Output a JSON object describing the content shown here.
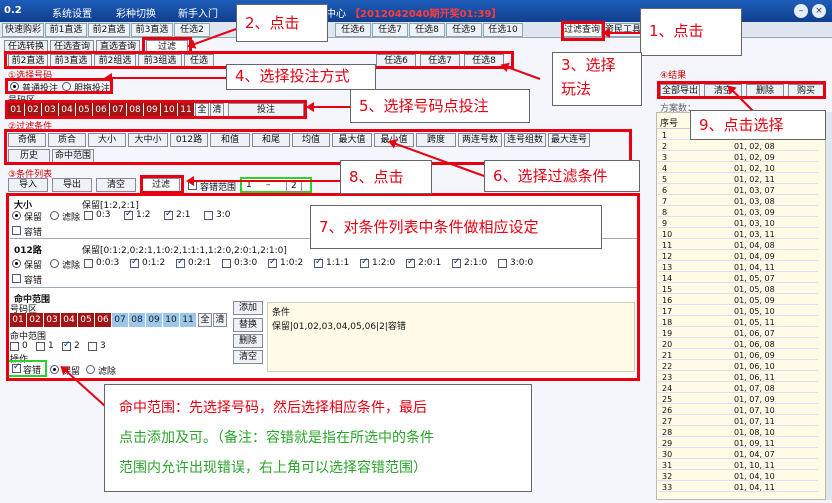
{
  "window": {
    "title": "0.2",
    "menu": [
      "系统设置",
      "彩种切换",
      "新手入门"
    ],
    "center": "中心",
    "notice": "【2012042040期开奖01:39】"
  },
  "tabs": [
    "快速购彩",
    "前1直选",
    "前2直选",
    "前3直选",
    "任选2",
    "任选3",
    "任选4",
    "任选5",
    "任选6",
    "任选7",
    "任选8",
    "任选9",
    "任选10",
    "过滤查询",
    "资民工具"
  ],
  "subtabs": [
    "任选转换",
    "任选查询",
    "直选查询",
    "过滤"
  ],
  "playtabs": [
    "前2直选",
    "前3直选",
    "前2组选",
    "前3组选",
    "任选"
  ],
  "playtabs_right": [
    "任选6",
    "任选7",
    "任选8"
  ],
  "sections": {
    "select_code": "①选择号码",
    "filter": "②过滤条件",
    "cond_list": "③条件列表",
    "result": "④结果"
  },
  "bet_mode": {
    "normal": "普通投注",
    "gall": "胆拖投注"
  },
  "number_area": "号码区",
  "numbers": [
    "01",
    "02",
    "03",
    "04",
    "05",
    "06",
    "07",
    "08",
    "09",
    "10",
    "11"
  ],
  "num_btns": {
    "all": "全",
    "clear": "清",
    "bet": "投注"
  },
  "filters_row1": [
    "奇偶",
    "质合",
    "大小",
    "大中小",
    "012路",
    "和值",
    "和尾",
    "均值",
    "最大值",
    "最小值",
    "跨度",
    "两连号数",
    "连号组数",
    "最大连号"
  ],
  "filters_row2": [
    "历史",
    "命中范围"
  ],
  "list_btns": {
    "import": "导入",
    "export": "导出",
    "clear": "清空",
    "filter": "过滤",
    "tol_label": "容错范围",
    "tol_from": "1",
    "tol_sep": "–",
    "tol_to": "2"
  },
  "block1": {
    "title": "大小",
    "keep_label": "保留[1:2,2:1]",
    "keep": "保留",
    "remove": "滤除",
    "opts": [
      "0:3",
      "1:2",
      "2:1",
      "3:0"
    ],
    "tol": "容错"
  },
  "block2": {
    "title": "012路",
    "keep_label": "保留[0:1:2,0:2:1,1:0:2,1:1:1,1:2:0,2:0:1,2:1:0]",
    "keep": "保留",
    "remove": "滤除",
    "opts": [
      "0:0:3",
      "0:1:2",
      "0:2:1",
      "0:3:0",
      "1:0:2",
      "1:1:1",
      "1:2:0",
      "2:0:1",
      "2:1:0",
      "3:0:0"
    ],
    "tol": "容错"
  },
  "block3": {
    "title": "命中范围",
    "numarea": "号码区",
    "hit": "命中范围",
    "hits": [
      "0",
      "1",
      "2",
      "3"
    ],
    "op": "操作",
    "tol": "容错",
    "keep": "保留",
    "remove": "滤除",
    "add": "添加",
    "replace": "替换",
    "delete": "删除",
    "clearb": "清空",
    "cond_header": "条件",
    "cond_value": "保留|01,02,03,04,05,06|2|容错"
  },
  "result": {
    "btns": [
      "全部导出",
      "清空",
      "删除",
      "购买"
    ],
    "count_label": "方案数：",
    "col": "序号",
    "rows": [
      [
        "1",
        ""
      ],
      [
        "2",
        "01, 02, 08"
      ],
      [
        "3",
        "01, 02, 09"
      ],
      [
        "4",
        "01, 02, 10"
      ],
      [
        "5",
        "01, 02, 11"
      ],
      [
        "6",
        "01, 03, 07"
      ],
      [
        "7",
        "01, 03, 08"
      ],
      [
        "8",
        "01, 03, 09"
      ],
      [
        "9",
        "01, 03, 10"
      ],
      [
        "10",
        "01, 03, 11"
      ],
      [
        "11",
        "01, 04, 08"
      ],
      [
        "12",
        "01, 04, 09"
      ],
      [
        "13",
        "01, 04, 11"
      ],
      [
        "14",
        "01, 05, 07"
      ],
      [
        "15",
        "01, 05, 08"
      ],
      [
        "16",
        "01, 05, 09"
      ],
      [
        "17",
        "01, 05, 10"
      ],
      [
        "18",
        "01, 05, 11"
      ],
      [
        "19",
        "01, 06, 07"
      ],
      [
        "20",
        "01, 06, 08"
      ],
      [
        "21",
        "01, 06, 09"
      ],
      [
        "22",
        "01, 06, 10"
      ],
      [
        "23",
        "01, 06, 11"
      ],
      [
        "24",
        "01, 07, 08"
      ],
      [
        "25",
        "01, 07, 09"
      ],
      [
        "26",
        "01, 07, 10"
      ],
      [
        "27",
        "01, 07, 11"
      ],
      [
        "28",
        "01, 08, 10"
      ],
      [
        "29",
        "01, 09, 11"
      ],
      [
        "30",
        "01, 04, 07"
      ],
      [
        "31",
        "01, 10, 11"
      ],
      [
        "32",
        "01, 04, 10"
      ],
      [
        "33",
        "01, 04, 11"
      ]
    ]
  },
  "callouts": {
    "c1": "1、点击",
    "c2": "2、点击",
    "c3a": "3、选择",
    "c3b": "玩法",
    "c4": "4、选择投注方式",
    "c5": "5、选择号码点投注",
    "c6": "6、选择过滤条件",
    "c7": "7、对条件列表中条件做相应设定",
    "c8": "8、点击",
    "c9": "9、点击选择",
    "big1": "命中范围：先选择号码，然后选择相应条件，最后",
    "big2": "点击添加及可。（备注：容错就是指在所选中的条件",
    "big3": "范围内允许出现错误，右上角可以选择容错范围）"
  }
}
